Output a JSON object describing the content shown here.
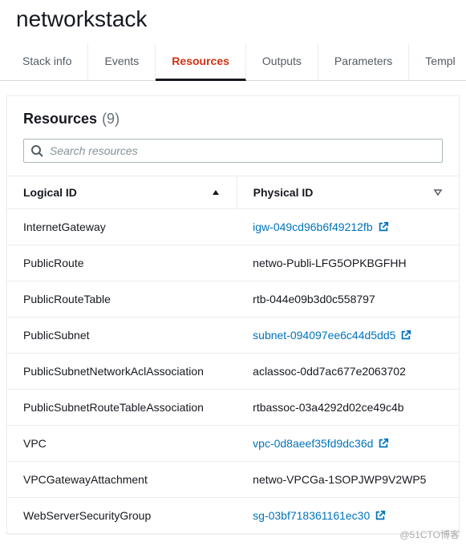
{
  "stack": {
    "name": "networkstack"
  },
  "tabs": [
    {
      "id": "info",
      "label": "Stack info",
      "active": false
    },
    {
      "id": "events",
      "label": "Events",
      "active": false
    },
    {
      "id": "resources",
      "label": "Resources",
      "active": true
    },
    {
      "id": "outputs",
      "label": "Outputs",
      "active": false
    },
    {
      "id": "parameters",
      "label": "Parameters",
      "active": false
    },
    {
      "id": "template",
      "label": "Templ",
      "active": false
    }
  ],
  "panel": {
    "title": "Resources",
    "count": "(9)"
  },
  "search": {
    "placeholder": "Search resources"
  },
  "columns": {
    "logical": "Logical ID",
    "physical": "Physical ID"
  },
  "rows": [
    {
      "logical": "InternetGateway",
      "physical": "igw-049cd96b6f49212fb",
      "link": true
    },
    {
      "logical": "PublicRoute",
      "physical": "netwo-Publi-LFG5OPKBGFHH",
      "link": false
    },
    {
      "logical": "PublicRouteTable",
      "physical": "rtb-044e09b3d0c558797",
      "link": false
    },
    {
      "logical": "PublicSubnet",
      "physical": "subnet-094097ee6c44d5dd5",
      "link": true
    },
    {
      "logical": "PublicSubnetNetworkAclAssociation",
      "physical": "aclassoc-0dd7ac677e2063702",
      "link": false
    },
    {
      "logical": "PublicSubnetRouteTableAssociation",
      "physical": "rtbassoc-03a4292d02ce49c4b",
      "link": false
    },
    {
      "logical": "VPC",
      "physical": "vpc-0d8aeef35fd9dc36d",
      "link": true
    },
    {
      "logical": "VPCGatewayAttachment",
      "physical": "netwo-VPCGa-1SOPJWP9V2WP5",
      "link": false
    },
    {
      "logical": "WebServerSecurityGroup",
      "physical": "sg-03bf718361161ec30",
      "link": true
    }
  ],
  "watermark": "@51CTO博客"
}
